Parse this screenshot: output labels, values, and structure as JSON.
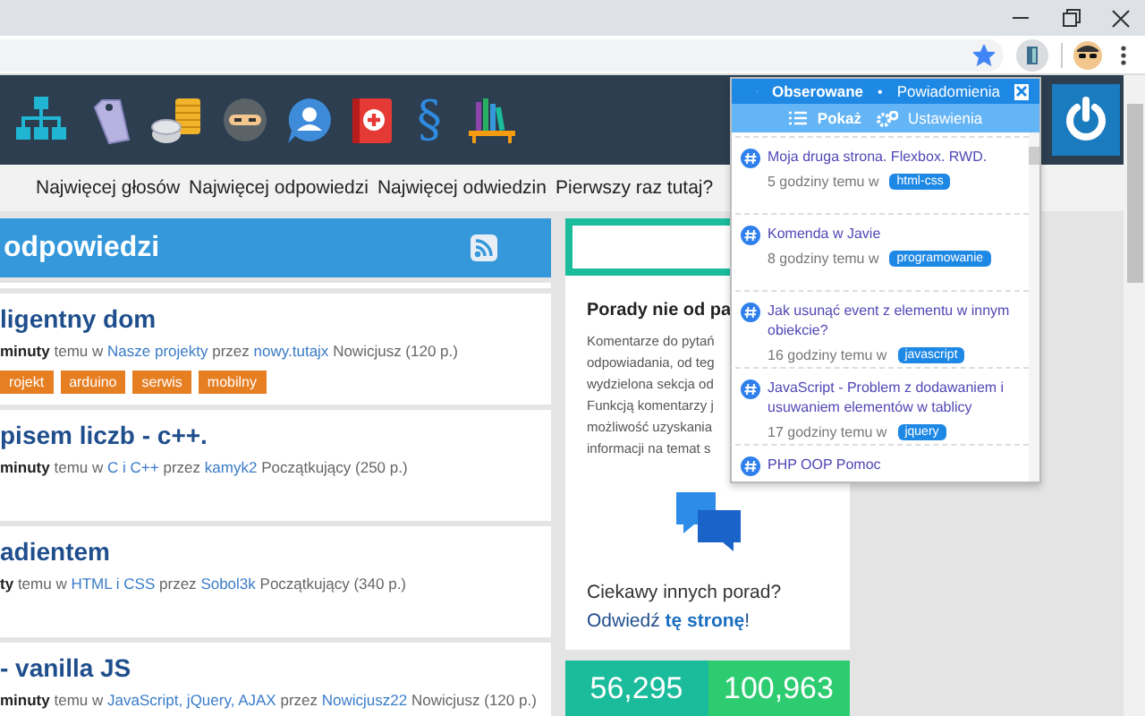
{
  "window_controls": [
    {
      "kind": "minimize"
    },
    {
      "kind": "maximize"
    },
    {
      "kind": "close"
    }
  ],
  "toolbar": {
    "bookmarked": true
  },
  "site_header": {
    "icons": [
      {
        "kind": "sitemap"
      },
      {
        "kind": "tag"
      },
      {
        "kind": "coins"
      },
      {
        "kind": "ninja"
      },
      {
        "kind": "person"
      },
      {
        "kind": "medkit"
      },
      {
        "kind": "glyph",
        "glyph": "§"
      },
      {
        "kind": "books"
      }
    ]
  },
  "nav": {
    "items": [
      "Najwięcej głosów",
      "Najwięcej odpowiedzi",
      "Najwięcej odwiedzin",
      "Pierwszy raz tutaj?"
    ]
  },
  "questions": {
    "title": "odpowiedzi",
    "items": [
      {
        "title": "ligentny dom",
        "meta": [
          {
            "text": "minuty",
            "kind": "bold"
          },
          {
            "text": "temu w",
            "kind": "plain"
          },
          {
            "text": "Nasze projekty",
            "kind": "link"
          },
          {
            "text": "przez",
            "kind": "plain"
          },
          {
            "text": "nowy.tutajx",
            "kind": "link"
          },
          {
            "text": "Nowicjusz (120 p.)",
            "kind": "plain"
          }
        ],
        "tags": [
          "rojekt",
          "arduino",
          "serwis",
          "mobilny"
        ]
      },
      {
        "title": "pisem liczb - c++.",
        "meta": [
          {
            "text": "minuty",
            "kind": "bold"
          },
          {
            "text": "temu w",
            "kind": "plain"
          },
          {
            "text": "C i C++",
            "kind": "link"
          },
          {
            "text": "przez",
            "kind": "plain"
          },
          {
            "text": "kamyk2",
            "kind": "link"
          },
          {
            "text": "Początkujący (250 p.)",
            "kind": "plain"
          }
        ]
      },
      {
        "title": "adientem",
        "meta": [
          {
            "text": "ty",
            "kind": "bold"
          },
          {
            "text": "temu w",
            "kind": "plain"
          },
          {
            "text": "HTML i CSS",
            "kind": "link"
          },
          {
            "text": "przez",
            "kind": "plain"
          },
          {
            "text": "Sobol3k",
            "kind": "link"
          },
          {
            "text": "Początkujący (340 p.)",
            "kind": "plain"
          }
        ]
      },
      {
        "title": "- vanilla JS",
        "meta": [
          {
            "text": "minuty",
            "kind": "bold"
          },
          {
            "text": "temu w",
            "kind": "plain"
          },
          {
            "text": "JavaScript, jQuery, AJAX",
            "kind": "link"
          },
          {
            "text": "przez",
            "kind": "plain"
          },
          {
            "text": "Nowicjusz22",
            "kind": "link"
          },
          {
            "text": "Nowicjusz (120 p.)",
            "kind": "plain"
          }
        ]
      }
    ]
  },
  "sidebar": {
    "title": "Porady nie od pa",
    "lines": [
      "Komentarze do pytań",
      "odpowiadania, od teg",
      "wydzielona sekcja od",
      "Funkcją komentarzy j",
      "możliwość uzyskania",
      "informacji na temat s"
    ],
    "question": "Ciekawy innych porad?",
    "visit": "Odwiedź **tę stronę**!"
  },
  "stats": [
    {
      "value": "56,295",
      "color": "#1abc9c"
    },
    {
      "value": "100,963",
      "color": "#2ecc71"
    }
  ],
  "popup": {
    "tabs": [
      {
        "label": "Obserowane",
        "selected": true
      },
      {
        "label": "Powiadomienia",
        "selected": false
      }
    ],
    "separator": "•",
    "actions": [
      {
        "label": "Pokaż",
        "kind": "list",
        "selected": true
      },
      {
        "label": "Ustawienia",
        "kind": "settings",
        "selected": false
      }
    ],
    "items": [
      {
        "title": "Moja druga strona. Flexbox. RWD.",
        "time": "5 godziny temu w",
        "tag": "html-css"
      },
      {
        "title": "Komenda w Javie",
        "time": "8 godziny temu w",
        "tag": "programowanie"
      },
      {
        "title": "Jak usunąć event z elementu w innym obiekcie?",
        "time": "16 godziny temu w",
        "tag": "javascript"
      },
      {
        "title": "JavaScript - Problem z dodawaniem i usuwaniem elementów w tablicy",
        "time": "17 godziny temu w",
        "tag": "jquery"
      },
      {
        "title": "PHP OOP Pomoc"
      }
    ]
  }
}
